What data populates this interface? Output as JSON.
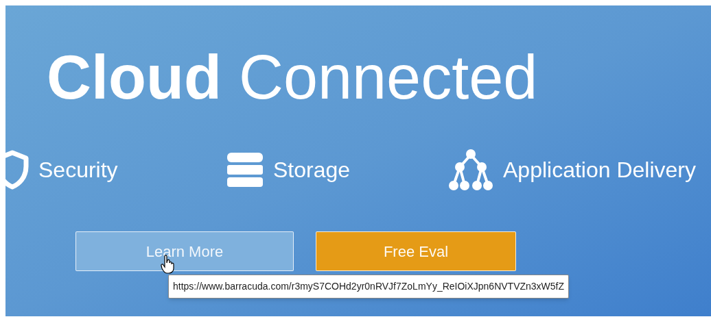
{
  "headline": "**Cloud** Connected",
  "features": [
    {
      "kind": "shield",
      "label": "Security"
    },
    {
      "kind": "database",
      "label": "Storage"
    },
    {
      "kind": "tree",
      "label": "Application Delivery"
    }
  ],
  "buttons": [
    {
      "kind": "outline",
      "label": "Learn More",
      "hovered": true
    },
    {
      "kind": "solid",
      "label": "Free Eval",
      "hovered": false
    }
  ],
  "tooltip": {
    "text": "https://www.barracuda.com/r3myS7COHd2yr0nRVJf7ZoLmYy_ReIOiXJpn6NVTVZn3xW5fZ"
  }
}
